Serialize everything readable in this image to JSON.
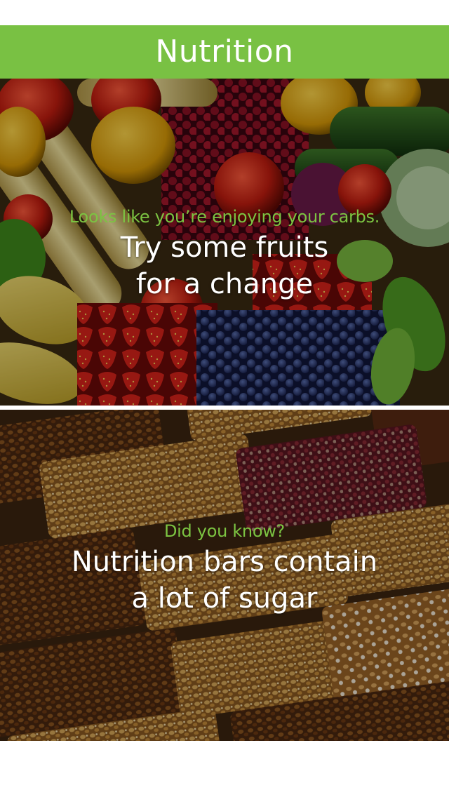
{
  "header": {
    "title": "Nutrition",
    "color": "#79c143"
  },
  "cards": [
    {
      "image": "vegetables-and-berries-photo",
      "kicker": "Looks like you’re enjoying your carbs.",
      "headline_lines": [
        "Try some fruits",
        "for a change"
      ]
    },
    {
      "image": "granola-bars-photo",
      "kicker": "Did you know?",
      "headline_lines": [
        "Nutrition bars contain",
        "a lot of sugar"
      ]
    }
  ],
  "colors": {
    "accent": "#7cc442",
    "headline": "#ffffff"
  }
}
